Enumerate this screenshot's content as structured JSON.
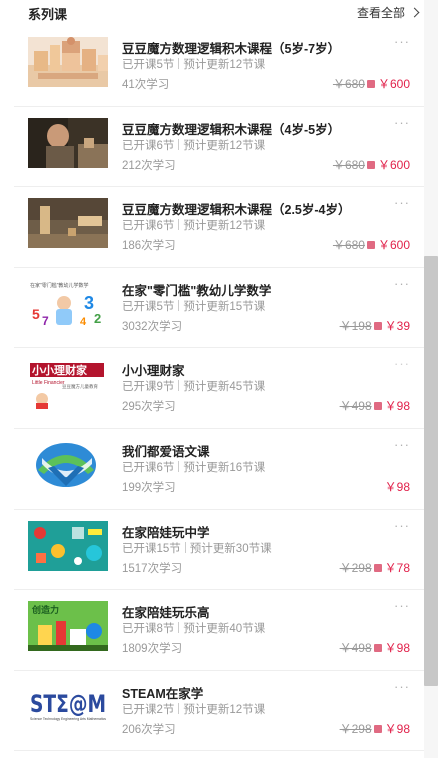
{
  "header": {
    "title": "系列课",
    "view_all": "查看全部"
  },
  "colors": {
    "price_red": "#e1224b",
    "muted_gray": "#999999",
    "scrollbar": "#c7c7c7"
  },
  "courses": [
    {
      "title": "豆豆魔方数理逻辑积木课程（5岁-7岁）",
      "opened": "已开课5节",
      "planned": "预计更新12节课",
      "learners": "41次学习",
      "original_price": "￥680",
      "price": "￥600",
      "has_coupon": true,
      "thumb": "wooden-blocks"
    },
    {
      "title": "豆豆魔方数理逻辑积木课程（4岁-5岁）",
      "opened": "已开课6节",
      "planned": "预计更新12节课",
      "learners": "212次学习",
      "original_price": "￥680",
      "price": "￥600",
      "has_coupon": true,
      "thumb": "child-photo"
    },
    {
      "title": "豆豆魔方数理逻辑积木课程（2.5岁-4岁）",
      "opened": "已开课6节",
      "planned": "预计更新12节课",
      "learners": "186次学习",
      "original_price": "￥680",
      "price": "￥600",
      "has_coupon": true,
      "thumb": "blocks-table"
    },
    {
      "title": "在家\"零门槛\"教幼儿学数学",
      "opened": "已开课5节",
      "planned": "预计更新15节课",
      "learners": "3032次学习",
      "original_price": "￥198",
      "price": "￥39",
      "has_coupon": true,
      "thumb": "numbers-baby"
    },
    {
      "title": "小小理财家",
      "opened": "已开课9节",
      "planned": "预计更新45节课",
      "learners": "295次学习",
      "original_price": "￥498",
      "price": "￥98",
      "has_coupon": true,
      "thumb": "little-financier"
    },
    {
      "title": "我们都爱语文课",
      "opened": "已开课6节",
      "planned": "预计更新16节课",
      "learners": "199次学习",
      "original_price": "",
      "price": "￥98",
      "has_coupon": false,
      "thumb": "blue-green-logo"
    },
    {
      "title": "在家陪娃玩中学",
      "opened": "已开课15节",
      "planned": "预计更新30节课",
      "learners": "1517次学习",
      "original_price": "￥298",
      "price": "￥78",
      "has_coupon": true,
      "thumb": "teal-pattern"
    },
    {
      "title": "在家陪娃玩乐高",
      "opened": "已开课8节",
      "planned": "预计更新40节课",
      "learners": "1809次学习",
      "original_price": "￥498",
      "price": "￥98",
      "has_coupon": true,
      "thumb": "creativity-green"
    },
    {
      "title": "STEAM在家学",
      "opened": "已开课2节",
      "planned": "预计更新12节课",
      "learners": "206次学习",
      "original_price": "￥298",
      "price": "￥98",
      "has_coupon": true,
      "thumb": "steam-logo"
    }
  ],
  "thumb_texts": {
    "little_financier_title": "小小理财家",
    "little_financier_en": "Little Financier",
    "little_financier_sub": "豆豆魔方儿童教育",
    "creativity_label": "创造力",
    "steam_title": "STΣ@M",
    "steam_sub": "Science Technology Engineering Arts Mathematics",
    "numbers_label": "3 4 5 7 2"
  },
  "more_icon": "more-dots-icon",
  "view_all_icon": "chevron-right-icon"
}
